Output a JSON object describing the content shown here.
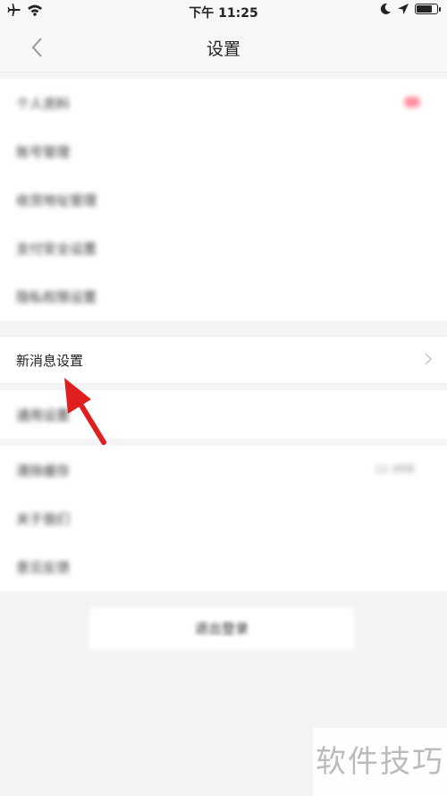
{
  "status_bar": {
    "time": "下午 11:25",
    "left_icons": [
      "airplane-icon",
      "wifi-icon"
    ],
    "right_icons": [
      "moon-icon",
      "location-icon",
      "battery-icon"
    ],
    "battery_level": 0.85
  },
  "nav": {
    "title": "设置",
    "back_icon": "chevron-left-icon"
  },
  "group1": {
    "items": [
      {
        "label": "个人资料",
        "blurred": true
      },
      {
        "label": "账号管理",
        "blurred": true
      },
      {
        "label": "收货地址管理",
        "blurred": true
      },
      {
        "label": "支付安全设置",
        "blurred": true
      },
      {
        "label": "隐私权限设置",
        "blurred": true
      }
    ]
  },
  "highlight_row": {
    "label": "新消息设置"
  },
  "group2": {
    "items": [
      {
        "label": "通用设置",
        "blurred": true
      }
    ]
  },
  "group3": {
    "items": [
      {
        "label": "清除缓存",
        "value": "12.3MB",
        "blurred": true
      },
      {
        "label": "关于我们",
        "blurred": true
      },
      {
        "label": "意见反馈",
        "blurred": true
      }
    ]
  },
  "logout": {
    "label": "退出登录"
  },
  "watermark": "软件技巧",
  "colors": {
    "accent_red": "#e01f1f",
    "background": "#f4f4f6"
  }
}
